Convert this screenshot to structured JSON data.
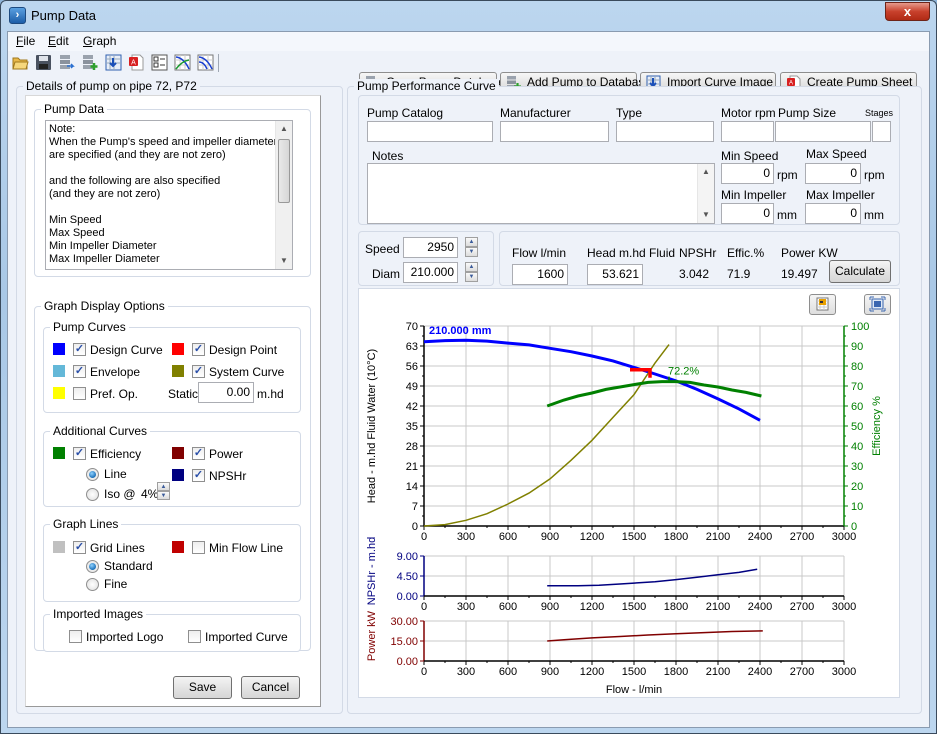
{
  "window": {
    "title": "Pump Data",
    "close_label": "x"
  },
  "menu": [
    {
      "label": "File",
      "accel": "F"
    },
    {
      "label": "Edit",
      "accel": "E"
    },
    {
      "label": "Graph",
      "accel": "G"
    }
  ],
  "toolbar_icons": [
    "open-folder-icon",
    "save-icon",
    "database-export-icon",
    "database-add-icon",
    "import-image-icon",
    "pdf-icon",
    "checklist-icon",
    "curve-graph-icon",
    "curve-envelope-icon"
  ],
  "action_buttons": [
    {
      "label": "Open Pump Database",
      "icon": "database-open-icon"
    },
    {
      "label": "Add Pump to Database",
      "icon": "database-add-icon"
    },
    {
      "label": "Import Curve Image",
      "icon": "import-image-icon"
    },
    {
      "label": "Create Pump Sheet",
      "icon": "pdf-icon"
    }
  ],
  "left_panel": {
    "title": "Details of pump on pipe 72, P72",
    "pump_data": {
      "title": "Pump Data",
      "note_lines": [
        "Note:",
        "When the Pump's speed and impeller diameter",
        "are specified (and they are not zero)",
        "",
        "and the following are also specified",
        "(and they are not zero)",
        "",
        "Min Speed",
        "Max Speed",
        "Min Impeller Diameter",
        "Max Impeller Diameter"
      ]
    },
    "graph_display_options": {
      "title": "Graph Display Options",
      "pump_curves": {
        "title": "Pump Curves",
        "items": [
          {
            "label": "Design Curve",
            "color": "#0000ff",
            "checked": true
          },
          {
            "label": "Design Point",
            "color": "#ff0000",
            "checked": true
          },
          {
            "label": "Envelope",
            "color": "#64b8d8",
            "checked": true
          },
          {
            "label": "System Curve",
            "color": "#808000",
            "checked": true
          },
          {
            "label": "Pref. Op.",
            "color": "#ffff00",
            "checked": false
          }
        ],
        "static_label": "Static",
        "static_value": "0.00",
        "static_unit": "m.hd"
      },
      "additional_curves": {
        "title": "Additional Curves",
        "efficiency": {
          "label": "Efficiency",
          "color": "#008000",
          "checked": true
        },
        "power": {
          "label": "Power",
          "color": "#800000",
          "checked": true
        },
        "npshr": {
          "label": "NPSHr",
          "color": "#000080",
          "checked": true
        },
        "line_label": "Line",
        "line_selected": true,
        "iso_label": "Iso @",
        "iso_value": "4%"
      },
      "graph_lines": {
        "title": "Graph Lines",
        "grid": {
          "label": "Grid Lines",
          "color": "#c0c0c0",
          "checked": true
        },
        "min_flow": {
          "label": "Min Flow Line",
          "color": "#c00000",
          "checked": false
        },
        "standard_label": "Standard",
        "standard_selected": true,
        "fine_label": "Fine"
      },
      "imported_images": {
        "title": "Imported Images",
        "logo": {
          "label": "Imported Logo",
          "checked": false
        },
        "curve": {
          "label": "Imported Curve",
          "checked": false
        }
      }
    },
    "save_label": "Save",
    "cancel_label": "Cancel"
  },
  "right_panel": {
    "title": "Pump Performance Curve",
    "labels": {
      "pump_catalog": "Pump Catalog",
      "manufacturer": "Manufacturer",
      "type": "Type",
      "motor_rpm": "Motor rpm",
      "pump_size": "Pump Size",
      "stages": "Stages",
      "notes": "Notes",
      "min_speed": "Min Speed",
      "max_speed": "Max Speed",
      "min_impeller": "Min Impeller",
      "max_impeller": "Max Impeller",
      "rpm": "rpm",
      "mm": "mm"
    },
    "values": {
      "pump_catalog": "",
      "manufacturer": "",
      "type": "",
      "motor_rpm": "",
      "pump_size": "",
      "stages": "",
      "notes": "",
      "min_speed": "0",
      "max_speed": "0",
      "min_impeller": "0",
      "max_impeller": "0"
    },
    "speed_label": "Speed",
    "speed_value": "2950",
    "diam_label": "Diam",
    "diam_value": "210.000",
    "calc": {
      "flow_label": "Flow l/min",
      "flow_value": "1600",
      "head_label": "Head m.hd Fluid",
      "head_value": "53.621",
      "npshr_label": "NPSHr",
      "npshr_value": "3.042",
      "effic_label": "Effic.%",
      "effic_value": "71.9",
      "power_label": "Power KW",
      "power_value": "19.497",
      "calculate_label": "Calculate"
    }
  },
  "chart_data": [
    {
      "type": "line",
      "title": "",
      "curve_label": "210.000 mm",
      "annotation": "72.2%",
      "xlabel": "",
      "ylabel": "Head - m.hd Fluid Water (10°C)",
      "y2label": "Efficiency %",
      "xlim": [
        0,
        3000
      ],
      "ylim": [
        0,
        70
      ],
      "y2lim": [
        0,
        100
      ],
      "xticks": [
        0,
        300,
        600,
        900,
        1200,
        1500,
        1800,
        2100,
        2400,
        2700,
        3000
      ],
      "yticks": [
        0,
        7,
        14,
        21,
        28,
        35,
        42,
        49,
        56,
        63,
        70
      ],
      "y2ticks": [
        0,
        10,
        20,
        30,
        40,
        50,
        60,
        70,
        80,
        90,
        100
      ],
      "grid": true,
      "series": [
        {
          "name": "Design Curve (Head)",
          "color": "#0000ff",
          "axis": "left",
          "x": [
            0,
            150,
            300,
            450,
            600,
            750,
            900,
            1050,
            1200,
            1350,
            1500,
            1650,
            1800,
            1950,
            2100,
            2250,
            2400
          ],
          "y": [
            64.5,
            64.9,
            65.0,
            64.7,
            64.0,
            63.4,
            62.2,
            61.0,
            59.5,
            57.8,
            55.5,
            53.2,
            50.8,
            47.8,
            44.5,
            41.0,
            37.0
          ]
        },
        {
          "name": "System Curve",
          "color": "#808000",
          "axis": "left",
          "x": [
            0,
            150,
            300,
            450,
            600,
            750,
            900,
            1050,
            1200,
            1350,
            1500,
            1650,
            1750
          ],
          "y": [
            0,
            0.5,
            2.0,
            4.3,
            7.7,
            11.5,
            16.5,
            23.0,
            30.0,
            38.0,
            46.0,
            57.0,
            63.5
          ]
        },
        {
          "name": "Efficiency",
          "color": "#008000",
          "axis": "right",
          "x": [
            880,
            1000,
            1100,
            1200,
            1300,
            1400,
            1500,
            1600,
            1700,
            1800,
            1900,
            2000,
            2100,
            2200,
            2300,
            2410
          ],
          "y": [
            60,
            63,
            65,
            66.5,
            68.3,
            69.5,
            70.7,
            71.8,
            72.2,
            72.2,
            71.8,
            70.5,
            69.5,
            68,
            66.8,
            65
          ]
        },
        {
          "name": "Design Point",
          "color": "#ff0000",
          "axis": "left",
          "x": [
            1600
          ],
          "y": [
            53.621
          ]
        }
      ],
      "bep": {
        "x": 1750,
        "efficiency": 72.2
      }
    },
    {
      "type": "line",
      "ylabel": "NPSHr - m.hd",
      "xlim": [
        0,
        3000
      ],
      "ylim": [
        0,
        9
      ],
      "xticks": [
        0,
        300,
        600,
        900,
        1200,
        1500,
        1800,
        2100,
        2400,
        2700,
        3000
      ],
      "yticks": [
        "0.00",
        "4.50",
        "9.00"
      ],
      "grid": true,
      "series": [
        {
          "name": "NPSHr",
          "color": "#000080",
          "x": [
            880,
            1000,
            1100,
            1250,
            1400,
            1500,
            1650,
            1800,
            1950,
            2100,
            2250,
            2380
          ],
          "y": [
            2.3,
            2.3,
            2.3,
            2.4,
            2.7,
            2.9,
            3.2,
            3.7,
            4.2,
            4.8,
            5.3,
            6.0
          ]
        }
      ]
    },
    {
      "type": "line",
      "ylabel": "Power kW",
      "xlabel": "Flow - l/min",
      "xlim": [
        0,
        3000
      ],
      "ylim": [
        0,
        30
      ],
      "xticks": [
        0,
        300,
        600,
        900,
        1200,
        1500,
        1800,
        2100,
        2400,
        2700,
        3000
      ],
      "yticks": [
        "0.00",
        "15.00",
        "30.00"
      ],
      "grid": true,
      "series": [
        {
          "name": "Power",
          "color": "#800000",
          "x": [
            880,
            1000,
            1200,
            1400,
            1600,
            1800,
            2000,
            2200,
            2420
          ],
          "y": [
            15.0,
            15.9,
            17.3,
            18.4,
            19.5,
            20.4,
            21.3,
            22.1,
            22.6
          ]
        }
      ]
    }
  ]
}
